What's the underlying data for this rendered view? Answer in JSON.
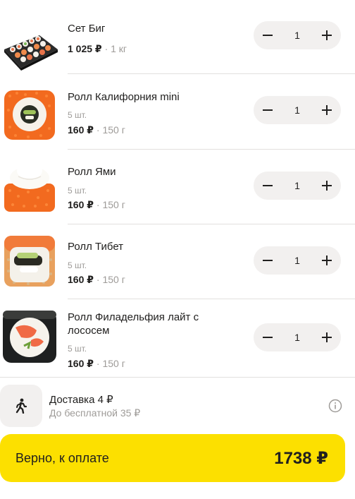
{
  "items": [
    {
      "name": "Сет Биг",
      "count": "",
      "price": "1 025 ₽",
      "weight": "· 1 кг",
      "qty": "1",
      "image": "sushi-set-tray"
    },
    {
      "name": "Ролл Калифорния mini",
      "count": "5 шт.",
      "price": "160 ₽",
      "weight": "· 150 г",
      "qty": "1",
      "image": "california-roll"
    },
    {
      "name": "Ролл Ями",
      "count": "5 шт.",
      "price": "160 ₽",
      "weight": "· 150 г",
      "qty": "1",
      "image": "yami-roll"
    },
    {
      "name": "Ролл Тибет",
      "count": "5 шт.",
      "price": "160 ₽",
      "weight": "· 150 г",
      "qty": "1",
      "image": "tibet-roll"
    },
    {
      "name": "Ролл Филадельфия лайт с лососем",
      "count": "5 шт.",
      "price": "160 ₽",
      "weight": "· 150 г",
      "qty": "1",
      "image": "philadelphia-roll"
    }
  ],
  "stepper": {
    "minus_icon": "minus-icon",
    "plus_icon": "plus-icon"
  },
  "delivery": {
    "title": "Доставка 4 ₽",
    "subtitle": "До бесплатной 35 ₽",
    "icon": "courier-walking-icon",
    "info_icon": "info-icon"
  },
  "checkout": {
    "label": "Верно, к оплате",
    "total": "1738 ₽",
    "color": "#fce000"
  },
  "colors": {
    "secondary_text": "#9e9b98",
    "stepper_bg": "#f2f0ef",
    "divider": "#e2e0de"
  }
}
